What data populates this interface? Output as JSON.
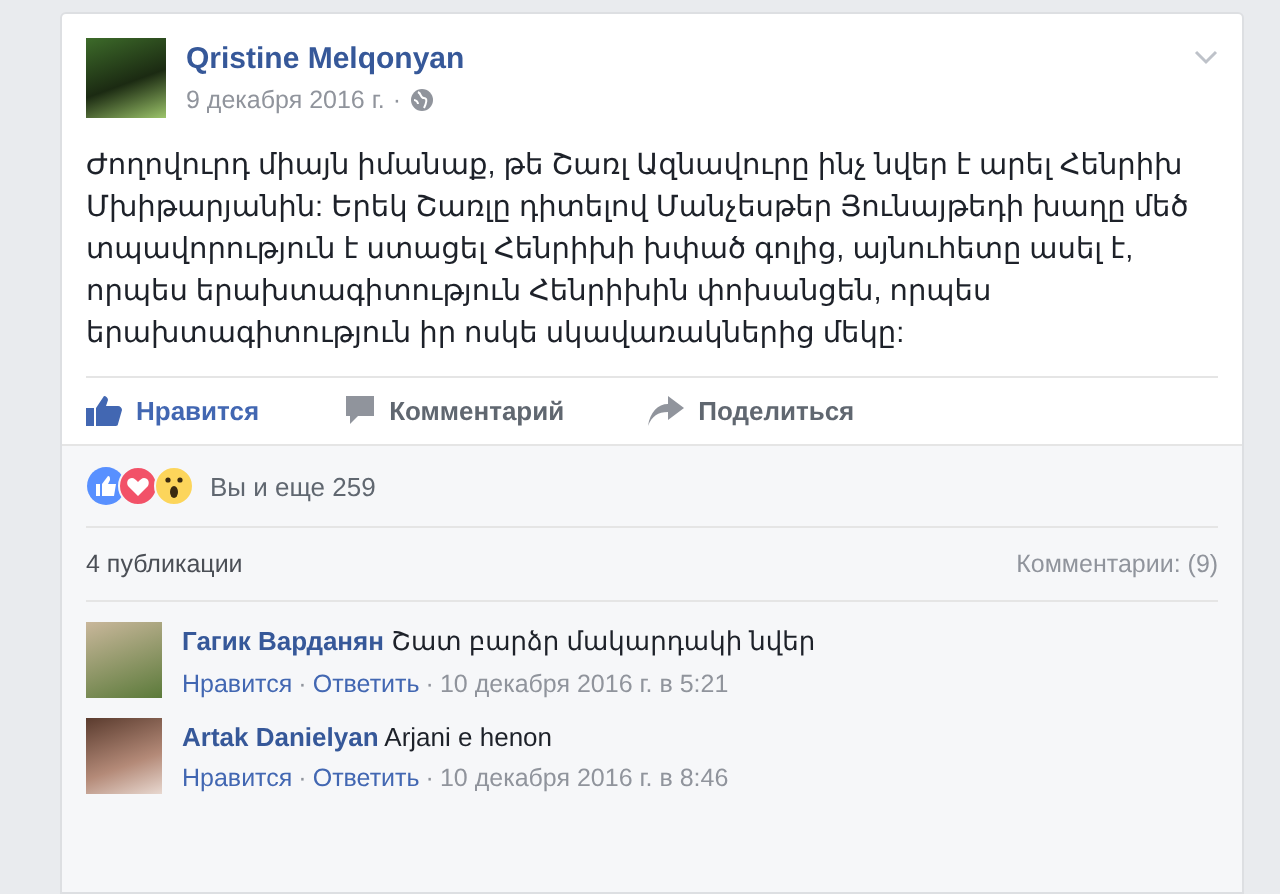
{
  "post": {
    "author": "Qristine Melqonyan",
    "date": "9 декабря 2016 г.",
    "separator": "·",
    "text": "Ժողովուրդ միայն իմանաք, թե Շառլ Ազնավուրը ինչ նվեր է արել Հենրիխ Մխիթարյանին: Երեկ Շառլը դիտելով Մանչեսթեր Յունայթեդի խաղը մեծ տպավորություն է ստացել Հենրիխի խփած գոլից, այնուհետը ասել է, որպես երախտագիտություն Հենրիխին փոխանցեն, որպես երախտագիտություն իր ոսկե սկավառակներից մեկը:",
    "actions": [
      {
        "kind": "like",
        "label": "Нравится",
        "selected": true
      },
      {
        "kind": "comment",
        "label": "Комментарий",
        "selected": false
      },
      {
        "kind": "share",
        "label": "Поделиться",
        "selected": false
      }
    ]
  },
  "reactions": {
    "summary": "Вы и еще 259"
  },
  "shares": "4 публикации",
  "comments_count": "Комментарии: (9)",
  "comments": [
    {
      "author": "Гагик Варданян",
      "text": "Շատ բարձր մակարդակի նվեր",
      "like": "Нравится",
      "reply": "Ответить",
      "time": "10 декабря 2016 г. в 5:21"
    },
    {
      "author": "Artak Danielyan",
      "text": "Arjani e henon",
      "like": "Нравится",
      "reply": "Ответить",
      "time": "10 декабря 2016 г. в 8:46"
    }
  ]
}
